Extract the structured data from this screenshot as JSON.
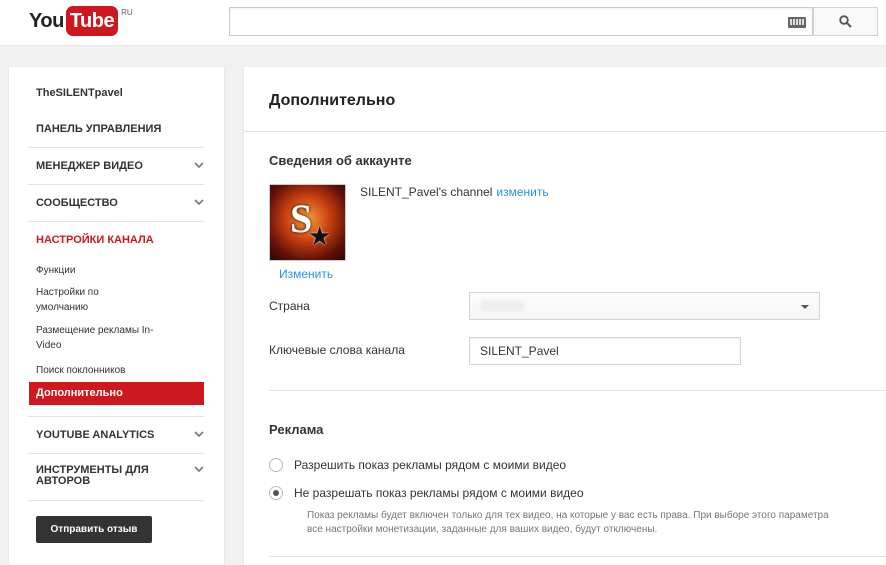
{
  "header": {
    "logo_you": "You",
    "logo_tube": "Tube",
    "logo_region": "RU",
    "search_placeholder": ""
  },
  "sidebar": {
    "channel_name": "TheSILENTpavel",
    "items": [
      {
        "label": "ПАНЕЛЬ УПРАВЛЕНИЯ"
      },
      {
        "label": "МЕНЕДЖЕР ВИДЕО"
      },
      {
        "label": "СООБЩЕСТВО"
      },
      {
        "label": "НАСТРОЙКИ КАНАЛА"
      },
      {
        "label": "YOUTUBE ANALYTICS"
      },
      {
        "label": "ИНСТРУМЕНТЫ ДЛЯ АВТОРОВ"
      }
    ],
    "subitems": [
      {
        "label": "Функции"
      },
      {
        "label": "Настройки по умолчанию"
      },
      {
        "label": "Размещение рекламы In-Video"
      },
      {
        "label": "Поиск поклонников"
      },
      {
        "label": "Дополнительно"
      }
    ],
    "feedback_label": "Отправить отзыв"
  },
  "main": {
    "title": "Дополнительно",
    "account_section": "Сведения об аккаунте",
    "channel_display_name": "SILENT_Pavel's channel",
    "channel_change_link": "изменить",
    "change_photo_link": "Изменить",
    "country_label": "Страна",
    "keywords_label": "Ключевые слова канала",
    "keywords_value": "SILENT_Pavel",
    "ads_section": "Реклама",
    "ads_options": [
      {
        "label": "Разрешить показ рекламы рядом с моими видео",
        "checked": false
      },
      {
        "label": "Не разрешать показ рекламы рядом с моими видео",
        "checked": true
      }
    ],
    "ads_note": "Показ рекламы будет включен только для тех видео, на которые у вас есть права. При выборе этого параметра все настройки монетизации, заданные для ваших видео, будут отключены."
  },
  "colors": {
    "brand_red": "#cc181e",
    "link_blue": "#2793e6"
  },
  "icons": [
    "keyboard-icon",
    "search-icon",
    "chevron-down-icon",
    "dropdown-caret-icon"
  ]
}
